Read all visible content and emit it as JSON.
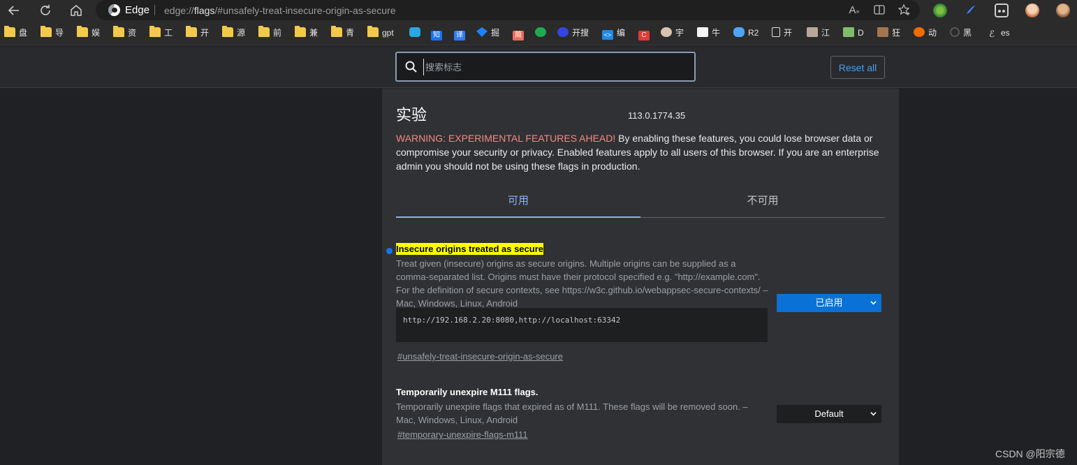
{
  "browser": {
    "site_label": "Edge",
    "url_scheme": "edge://",
    "url_host": "flags",
    "url_path": "/#unsafely-treat-insecure-origin-as-secure"
  },
  "bookmarks": [
    {
      "label": "盘",
      "icon": "folder-icon"
    },
    {
      "label": "导",
      "icon": "folder-icon"
    },
    {
      "label": "娱",
      "icon": "folder-icon"
    },
    {
      "label": "资",
      "icon": "folder-icon"
    },
    {
      "label": "工",
      "icon": "folder-icon"
    },
    {
      "label": "开",
      "icon": "folder-icon"
    },
    {
      "label": "源",
      "icon": "folder-icon"
    },
    {
      "label": "前",
      "icon": "folder-icon"
    },
    {
      "label": "兼",
      "icon": "folder-icon"
    },
    {
      "label": "青",
      "icon": "folder-icon"
    },
    {
      "label": "gpt",
      "icon": "folder-icon"
    },
    {
      "label": "",
      "icon": "bilibili-icon"
    },
    {
      "label": "",
      "icon": "zhihu-icon"
    },
    {
      "label": "",
      "icon": "translate-icon"
    },
    {
      "label": "掘",
      "icon": "juejin-icon"
    },
    {
      "label": "简",
      "icon": "jianshu-icon"
    },
    {
      "label": "",
      "icon": "c-icon"
    },
    {
      "label": "开搜",
      "icon": "kaisou-icon"
    },
    {
      "label": "编",
      "icon": "code-icon"
    },
    {
      "label": "",
      "icon": "csdn-icon"
    },
    {
      "label": "宇",
      "icon": "avatar-icon"
    },
    {
      "label": "牛",
      "icon": "niuke-icon"
    },
    {
      "label": "R2",
      "icon": "cloud-icon"
    },
    {
      "label": "开",
      "icon": "page-icon"
    },
    {
      "label": "江",
      "icon": "avatar-icon"
    },
    {
      "label": "D",
      "icon": "avatar-icon"
    },
    {
      "label": "狂",
      "icon": "avatar-icon"
    },
    {
      "label": "动",
      "icon": "anim-icon"
    },
    {
      "label": "黑",
      "icon": "circle-icon"
    },
    {
      "label": "es",
      "icon": "es-icon"
    }
  ],
  "header": {
    "search_placeholder": "搜索标志",
    "reset_label": "Reset all"
  },
  "content": {
    "title": "实验",
    "version": "113.0.1774.35",
    "warning_prefix": "WARNING: EXPERIMENTAL FEATURES AHEAD!",
    "warning_body": " By enabling these features, you could lose browser data or compromise your security or privacy. Enabled features apply to all users of this browser. If you are an enterprise admin you should not be using these flags in production.",
    "tabs": [
      {
        "label": "可用"
      },
      {
        "label": "不可用"
      }
    ],
    "flags": [
      {
        "title": "Insecure origins treated as secure",
        "description": "Treat given (insecure) origins as secure origins. Multiple origins can be supplied as a comma-separated list. Origins must have their protocol specified e.g. \"http://example.com\". For the definition of secure contexts, see https://w3c.github.io/webappsec-secure-contexts/ – Mac, Windows, Linux, Android",
        "textarea_value": "http://192.168.2.20:8080,http://localhost:63342",
        "link": "#unsafely-treat-insecure-origin-as-secure",
        "select_value": "已启用"
      },
      {
        "title": "Temporarily unexpire M111 flags.",
        "description": "Temporarily unexpire flags that expired as of M111. These flags will be removed soon. – Mac, Windows, Linux, Android",
        "link": "#temporary-unexpire-flags-m111",
        "select_value": "Default"
      }
    ]
  },
  "watermark": "CSDN @阳宗德",
  "colors": {
    "accent": "#8ab4f8",
    "warning": "#f28b82",
    "highlight": "#ffff00",
    "enabled_select": "#0a72d6"
  }
}
